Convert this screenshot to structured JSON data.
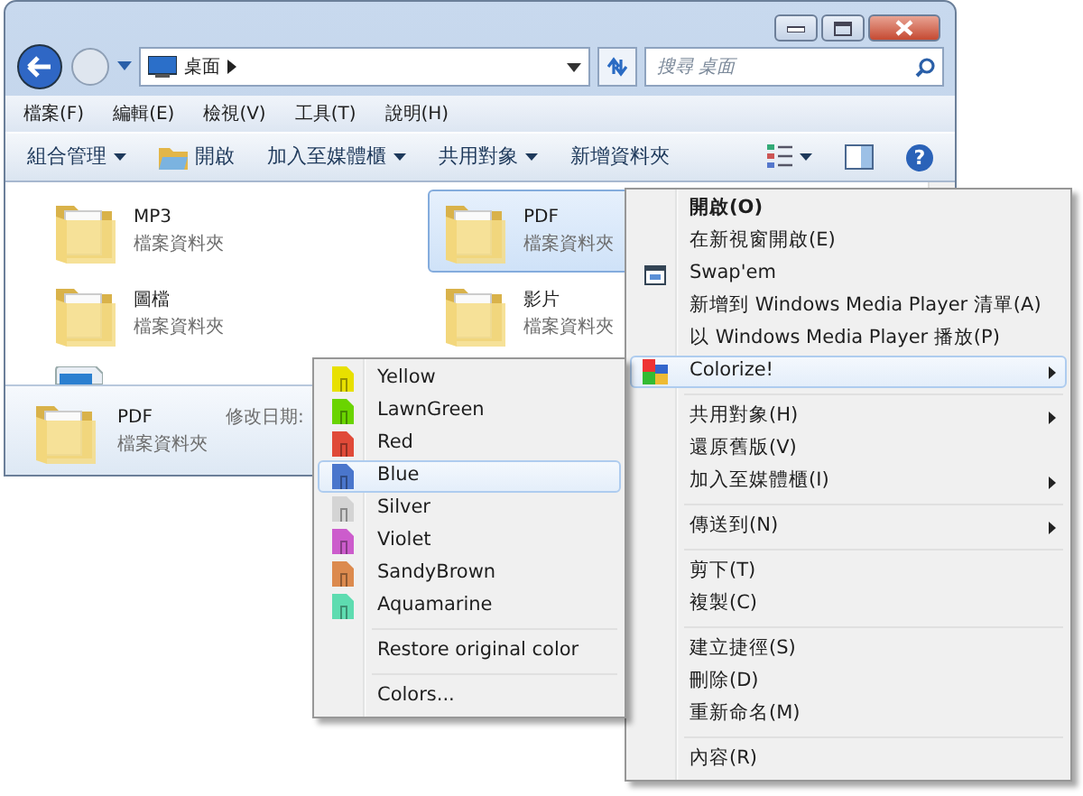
{
  "nav": {
    "address": "桌面",
    "search_placeholder": "搜尋 桌面"
  },
  "menu_bar": [
    "檔案(F)",
    "編輯(E)",
    "檢視(V)",
    "工具(T)",
    "說明(H)"
  ],
  "toolbar": [
    {
      "label": "組合管理",
      "kind": "dropdown"
    },
    {
      "label": "開啟",
      "kind": "open"
    },
    {
      "label": "加入至媒體櫃",
      "kind": "dropdown"
    },
    {
      "label": "共用對象",
      "kind": "dropdown"
    },
    {
      "label": "新增資料夾",
      "kind": "plain"
    }
  ],
  "help_button": "?",
  "files": [
    {
      "name": "MP3",
      "type": "檔案資料夾",
      "selected": false
    },
    {
      "name": "PDF",
      "type": "檔案資料夾",
      "selected": true
    },
    {
      "name": "圖檔",
      "type": "檔案資料夾",
      "selected": false
    },
    {
      "name": "影片",
      "type": "檔案資料夾",
      "selected": false
    }
  ],
  "details": {
    "name": "PDF",
    "type": "檔案資料夾",
    "label": "修改日期:"
  },
  "context_menu": [
    {
      "kind": "item",
      "label": "開啟(O)",
      "bold": true,
      "submenu": false,
      "selected": false
    },
    {
      "kind": "item",
      "label": "在新視窗開啟(E)",
      "bold": false,
      "submenu": false,
      "selected": false
    },
    {
      "kind": "app",
      "label": "Swap'em",
      "bold": false,
      "submenu": false,
      "selected": false
    },
    {
      "kind": "item",
      "label": "新增到 Windows Media Player 清單(A)",
      "bold": false,
      "submenu": false,
      "selected": false
    },
    {
      "kind": "item",
      "label": "以 Windows Media Player 播放(P)",
      "bold": false,
      "submenu": false,
      "selected": false
    },
    {
      "kind": "colorize",
      "label": "Colorize!",
      "bold": false,
      "submenu": true,
      "selected": true
    },
    {
      "kind": "separator"
    },
    {
      "kind": "item",
      "label": "共用對象(H)",
      "bold": false,
      "submenu": true,
      "selected": false
    },
    {
      "kind": "item",
      "label": "還原舊版(V)",
      "bold": false,
      "submenu": false,
      "selected": false
    },
    {
      "kind": "item",
      "label": "加入至媒體櫃(I)",
      "bold": false,
      "submenu": true,
      "selected": false
    },
    {
      "kind": "separator"
    },
    {
      "kind": "item",
      "label": "傳送到(N)",
      "bold": false,
      "submenu": true,
      "selected": false
    },
    {
      "kind": "separator"
    },
    {
      "kind": "item",
      "label": "剪下(T)",
      "bold": false,
      "submenu": false,
      "selected": false
    },
    {
      "kind": "item",
      "label": "複製(C)",
      "bold": false,
      "submenu": false,
      "selected": false
    },
    {
      "kind": "separator"
    },
    {
      "kind": "item",
      "label": "建立捷徑(S)",
      "bold": false,
      "submenu": false,
      "selected": false
    },
    {
      "kind": "item",
      "label": "刪除(D)",
      "bold": false,
      "submenu": false,
      "selected": false
    },
    {
      "kind": "item",
      "label": "重新命名(M)",
      "bold": false,
      "submenu": false,
      "selected": false
    },
    {
      "kind": "separator"
    },
    {
      "kind": "item",
      "label": "內容(R)",
      "bold": false,
      "submenu": false,
      "selected": false
    }
  ],
  "color_menu": [
    {
      "kind": "color",
      "label": "Yellow",
      "color": "#e8e000",
      "selected": false
    },
    {
      "kind": "color",
      "label": "LawnGreen",
      "color": "#6ad400",
      "selected": false
    },
    {
      "kind": "color",
      "label": "Red",
      "color": "#e04a38",
      "selected": false
    },
    {
      "kind": "color",
      "label": "Blue",
      "color": "#4a76cc",
      "selected": true
    },
    {
      "kind": "color",
      "label": "Silver",
      "color": "#d4d4d4",
      "selected": false
    },
    {
      "kind": "color",
      "label": "Violet",
      "color": "#cc5ccc",
      "selected": false
    },
    {
      "kind": "color",
      "label": "SandyBrown",
      "color": "#dc8a4e",
      "selected": false
    },
    {
      "kind": "color",
      "label": "Aquamarine",
      "color": "#5edcb0",
      "selected": false
    },
    {
      "kind": "separator"
    },
    {
      "kind": "item",
      "label": "Restore original color",
      "selected": false
    },
    {
      "kind": "separator"
    },
    {
      "kind": "item",
      "label": "Colors...",
      "selected": false
    }
  ]
}
